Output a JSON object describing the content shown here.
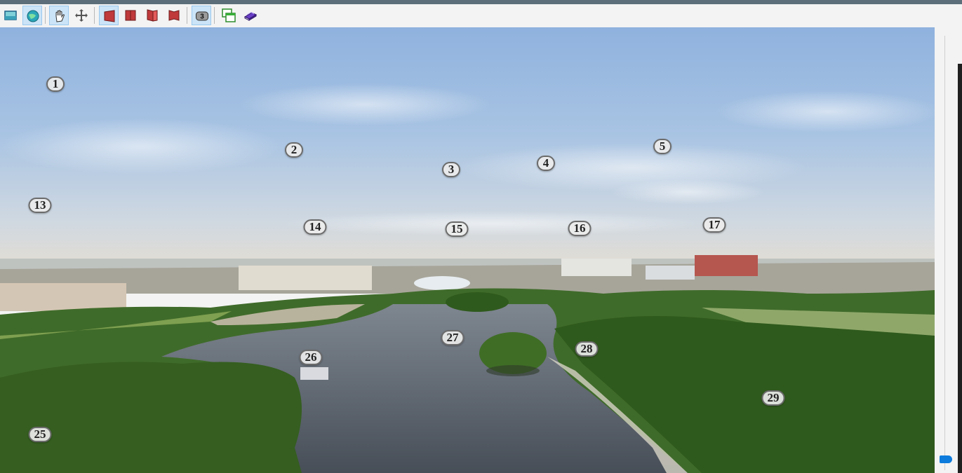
{
  "toolbar": {
    "buttons": [
      {
        "name": "flat-view-button",
        "icon": "flat-panorama-icon",
        "active": false
      },
      {
        "name": "sphere-view-button",
        "icon": "globe-icon",
        "active": true
      },
      {
        "name": "pan-tool-button",
        "icon": "hand-icon",
        "active": true
      },
      {
        "name": "move-tool-button",
        "icon": "move-arrows-icon",
        "active": false
      },
      {
        "name": "view-mode-1-button",
        "icon": "red-panel-icon",
        "active": true
      },
      {
        "name": "view-mode-2-button",
        "icon": "red-panel-icon",
        "active": false
      },
      {
        "name": "view-mode-3-button",
        "icon": "red-panel-icon",
        "active": false
      },
      {
        "name": "view-mode-4-button",
        "icon": "red-panel-icon",
        "active": false
      },
      {
        "name": "hotspot-labels-button",
        "icon": "badge-icon",
        "active": true,
        "label": "3"
      },
      {
        "name": "new-window-button",
        "icon": "window-icon",
        "active": false
      },
      {
        "name": "help-book-button",
        "icon": "book-icon",
        "active": false
      }
    ]
  },
  "hotspots": [
    {
      "id": "hs-1",
      "label": "1"
    },
    {
      "id": "hs-2",
      "label": "2"
    },
    {
      "id": "hs-3",
      "label": "3"
    },
    {
      "id": "hs-4",
      "label": "4"
    },
    {
      "id": "hs-5",
      "label": "5"
    },
    {
      "id": "hs-13",
      "label": "13"
    },
    {
      "id": "hs-14",
      "label": "14"
    },
    {
      "id": "hs-15",
      "label": "15"
    },
    {
      "id": "hs-16",
      "label": "16"
    },
    {
      "id": "hs-17",
      "label": "17"
    },
    {
      "id": "hs-25",
      "label": "25"
    },
    {
      "id": "hs-26",
      "label": "26"
    },
    {
      "id": "hs-27",
      "label": "27"
    },
    {
      "id": "hs-28",
      "label": "28"
    },
    {
      "id": "hs-29",
      "label": "29"
    }
  ],
  "colors": {
    "accent": "#0c7bdc",
    "active_button_bg": "#cce4f7",
    "sky_top": "#8fb3de",
    "water": "#56606b",
    "forest": "#2f5a1d"
  }
}
